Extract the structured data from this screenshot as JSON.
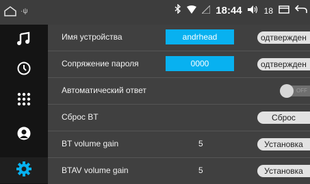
{
  "statusbar": {
    "usb_label": "·ψ",
    "time": "18:44",
    "volume_level": "18"
  },
  "sidebar": {
    "items": [
      {
        "icon": "music-note-icon"
      },
      {
        "icon": "clock-icon"
      },
      {
        "icon": "dialpad-icon"
      },
      {
        "icon": "contacts-icon"
      },
      {
        "icon": "settings-gear-icon",
        "active": true
      }
    ]
  },
  "settings": {
    "device_name": {
      "label": "Имя устройства",
      "value": "andrhead",
      "button": "одтвержден"
    },
    "pin": {
      "label": "Сопряжение пароля",
      "value": "0000",
      "button": "одтвержден"
    },
    "auto_answer": {
      "label": "Автоматический ответ",
      "toggle_text": "OFF"
    },
    "reset": {
      "label": "Сброс BT",
      "button": "Сброс"
    },
    "bt_volume": {
      "label": "BT volume gain",
      "value": "5",
      "button": "Установка"
    },
    "btav_volume": {
      "label": "BTAV volume gain",
      "value": "5",
      "button": "Установка"
    }
  },
  "colors": {
    "accent_blue": "#08b1f0",
    "sidebar_bg": "#141414",
    "content_bg": "#404040"
  }
}
